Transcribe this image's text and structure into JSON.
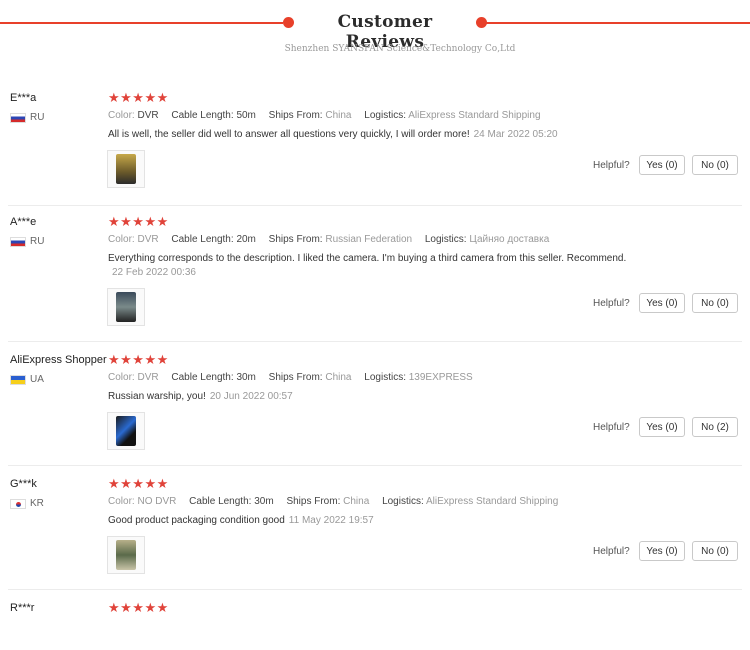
{
  "header": {
    "title": "Customer Reviews",
    "subtitle": "Shenzhen SYANSPAN Science&Technology Co,Ltd"
  },
  "colors": {
    "accent": "#e8402a",
    "star": "#e0433a"
  },
  "icons": {
    "star": "star-icon",
    "flag": "flag-icon"
  },
  "reviews": [
    {
      "name": "E***a",
      "country": "RU",
      "flag": "ru",
      "stars": "★★★★★",
      "rating": 5,
      "color_label": "Color:",
      "color": "DVR",
      "cable_label": "Cable Length:",
      "cable": "50m",
      "ships_label": "Ships From:",
      "ships": "China",
      "logistics_label": "Logistics:",
      "logistics": "AliExpress Standard Shipping",
      "text": "All is well, the seller did well to answer all questions very quickly, I will order more!",
      "date": "24 Mar 2022 05:20",
      "helpful": "Helpful?",
      "yes": "Yes (0)",
      "no": "No (0)"
    },
    {
      "name": "A***e",
      "country": "RU",
      "flag": "ru",
      "stars": "★★★★★",
      "rating": 5,
      "color_label": "Color:",
      "color": "DVR",
      "cable_label": "Cable Length:",
      "cable": "20m",
      "ships_label": "Ships From:",
      "ships": "Russian Federation",
      "logistics_label": "Logistics:",
      "logistics": "Цайняо доставка",
      "text": "Everything corresponds to the description. I liked the camera. I'm buying a third camera from this seller. Recommend.",
      "date": "22 Feb 2022 00:36",
      "helpful": "Helpful?",
      "yes": "Yes (0)",
      "no": "No (0)"
    },
    {
      "name": "AliExpress Shopper",
      "country": "UA",
      "flag": "ua",
      "stars": "★★★★★",
      "rating": 5,
      "color_label": "Color:",
      "color": "DVR",
      "cable_label": "Cable Length:",
      "cable": "30m",
      "ships_label": "Ships From:",
      "ships": "China",
      "logistics_label": "Logistics:",
      "logistics": "139EXPRESS",
      "text": "Russian warship, you!",
      "date": "20 Jun 2022 00:57",
      "helpful": "Helpful?",
      "yes": "Yes (0)",
      "no": "No (2)"
    },
    {
      "name": "G***k",
      "country": "KR",
      "flag": "kr",
      "stars": "★★★★★",
      "rating": 5,
      "color_label": "Color:",
      "color": "NO DVR",
      "cable_label": "Cable Length:",
      "cable": "30m",
      "ships_label": "Ships From:",
      "ships": "China",
      "logistics_label": "Logistics:",
      "logistics": "AliExpress Standard Shipping",
      "text": "Good product packaging condition good",
      "date": "11 May 2022 19:57",
      "helpful": "Helpful?",
      "yes": "Yes (0)",
      "no": "No (0)"
    },
    {
      "name": "R***r",
      "stars": "★★★★★",
      "rating": 5
    }
  ]
}
